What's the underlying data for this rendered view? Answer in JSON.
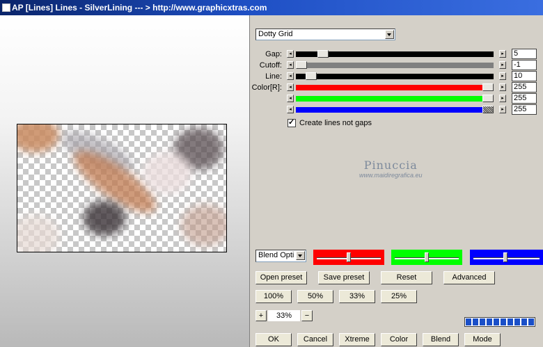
{
  "window": {
    "title": "AP [Lines]  Lines - SilverLining     --- > http://www.graphicxtras.com"
  },
  "effect_select": {
    "value": "Dotty Grid"
  },
  "sliders": {
    "gap": {
      "label": "Gap:",
      "value": "5"
    },
    "cutoff": {
      "label": "Cutoff:",
      "value": "-1"
    },
    "line": {
      "label": "Line:",
      "value": "10"
    },
    "color_r": {
      "label": "Color[R]:",
      "value": "255"
    },
    "color_g": {
      "label": "",
      "value": "255"
    },
    "color_b": {
      "label": "",
      "value": "255"
    }
  },
  "checkbox": {
    "label": "Create lines not gaps",
    "checked": true
  },
  "watermark": {
    "line1": "Pinuccia",
    "line2": "www.maidiregrafica.eu"
  },
  "blend_select": {
    "value": "Blend Opti"
  },
  "colors": {
    "red": "#ff0000",
    "green": "#00ff00",
    "blue": "#0000ff"
  },
  "buttons": {
    "open_preset": "Open preset",
    "save_preset": "Save preset",
    "reset": "Reset",
    "advanced": "Advanced",
    "zoom100": "100%",
    "zoom50": "50%",
    "zoom33": "33%",
    "zoom25": "25%",
    "zoom_in": "+",
    "zoom_out": "−",
    "ok": "OK",
    "cancel": "Cancel",
    "xtreme": "Xtreme",
    "color": "Color",
    "blend": "Blend",
    "mode": "Mode"
  },
  "zoom_value": "33%"
}
